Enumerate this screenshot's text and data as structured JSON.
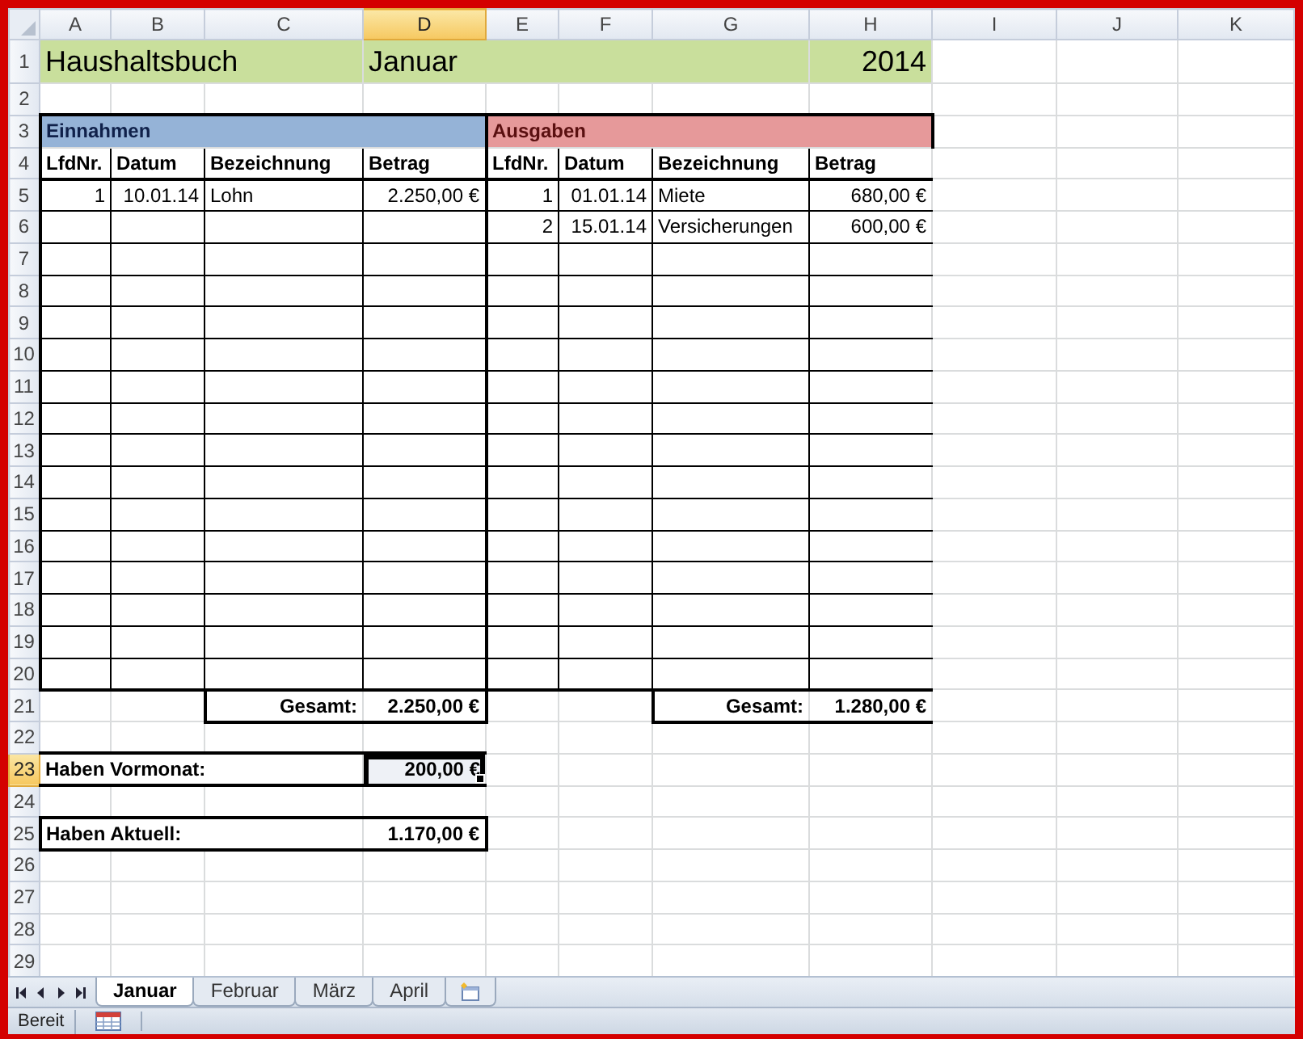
{
  "column_headers": [
    {
      "label": "A",
      "selected": false
    },
    {
      "label": "B",
      "selected": false
    },
    {
      "label": "C",
      "selected": false
    },
    {
      "label": "D",
      "selected": true
    },
    {
      "label": "E",
      "selected": false
    },
    {
      "label": "F",
      "selected": false
    },
    {
      "label": "G",
      "selected": false
    },
    {
      "label": "H",
      "selected": false
    },
    {
      "label": "I",
      "selected": false
    },
    {
      "label": "J",
      "selected": false
    },
    {
      "label": "K",
      "selected": false
    }
  ],
  "row_headers": [
    {
      "label": "1",
      "selected": false
    },
    {
      "label": "2",
      "selected": false
    },
    {
      "label": "3",
      "selected": false
    },
    {
      "label": "4",
      "selected": false
    },
    {
      "label": "5",
      "selected": false
    },
    {
      "label": "6",
      "selected": false
    },
    {
      "label": "7",
      "selected": false
    },
    {
      "label": "8",
      "selected": false
    },
    {
      "label": "9",
      "selected": false
    },
    {
      "label": "10",
      "selected": false
    },
    {
      "label": "11",
      "selected": false
    },
    {
      "label": "12",
      "selected": false
    },
    {
      "label": "13",
      "selected": false
    },
    {
      "label": "14",
      "selected": false
    },
    {
      "label": "15",
      "selected": false
    },
    {
      "label": "16",
      "selected": false
    },
    {
      "label": "17",
      "selected": false
    },
    {
      "label": "18",
      "selected": false
    },
    {
      "label": "19",
      "selected": false
    },
    {
      "label": "20",
      "selected": false
    },
    {
      "label": "21",
      "selected": false
    },
    {
      "label": "22",
      "selected": false
    },
    {
      "label": "23",
      "selected": true
    },
    {
      "label": "24",
      "selected": false
    },
    {
      "label": "25",
      "selected": false
    },
    {
      "label": "26",
      "selected": false
    },
    {
      "label": "27",
      "selected": false
    },
    {
      "label": "28",
      "selected": false
    },
    {
      "label": "29",
      "selected": false
    }
  ],
  "title": {
    "text": "Haushaltsbuch",
    "month": "Januar",
    "year": "2014"
  },
  "income": {
    "heading": "Einnahmen",
    "columns": [
      "LfdNr.",
      "Datum",
      "Bezeichnung",
      "Betrag"
    ],
    "rows": [
      {
        "number": "1",
        "date": "10.01.14",
        "description": "Lohn",
        "amount": "2.250,00 €"
      }
    ],
    "total_label": "Gesamt:",
    "total": "2.250,00 €"
  },
  "expenses": {
    "heading": "Ausgaben",
    "columns": [
      "LfdNr.",
      "Datum",
      "Bezeichnung",
      "Betrag"
    ],
    "rows": [
      {
        "number": "1",
        "date": "01.01.14",
        "description": "Miete",
        "amount": "680,00 €"
      },
      {
        "number": "2",
        "date": "15.01.14",
        "description": "Versicherungen",
        "amount": "600,00 €"
      }
    ],
    "total_label": "Gesamt:",
    "total": "1.280,00 €"
  },
  "balance": [
    {
      "label": "Haben Vormonat:",
      "value": "200,00 €",
      "selected": true
    },
    {
      "label": "Haben Aktuell:",
      "value": "1.170,00 €",
      "selected": false
    }
  ],
  "sheet_tabs": [
    {
      "label": "Januar",
      "selected": true
    },
    {
      "label": "Februar",
      "selected": false
    },
    {
      "label": "März",
      "selected": false
    },
    {
      "label": "April",
      "selected": false
    }
  ],
  "status_bar": {
    "text": "Bereit"
  }
}
